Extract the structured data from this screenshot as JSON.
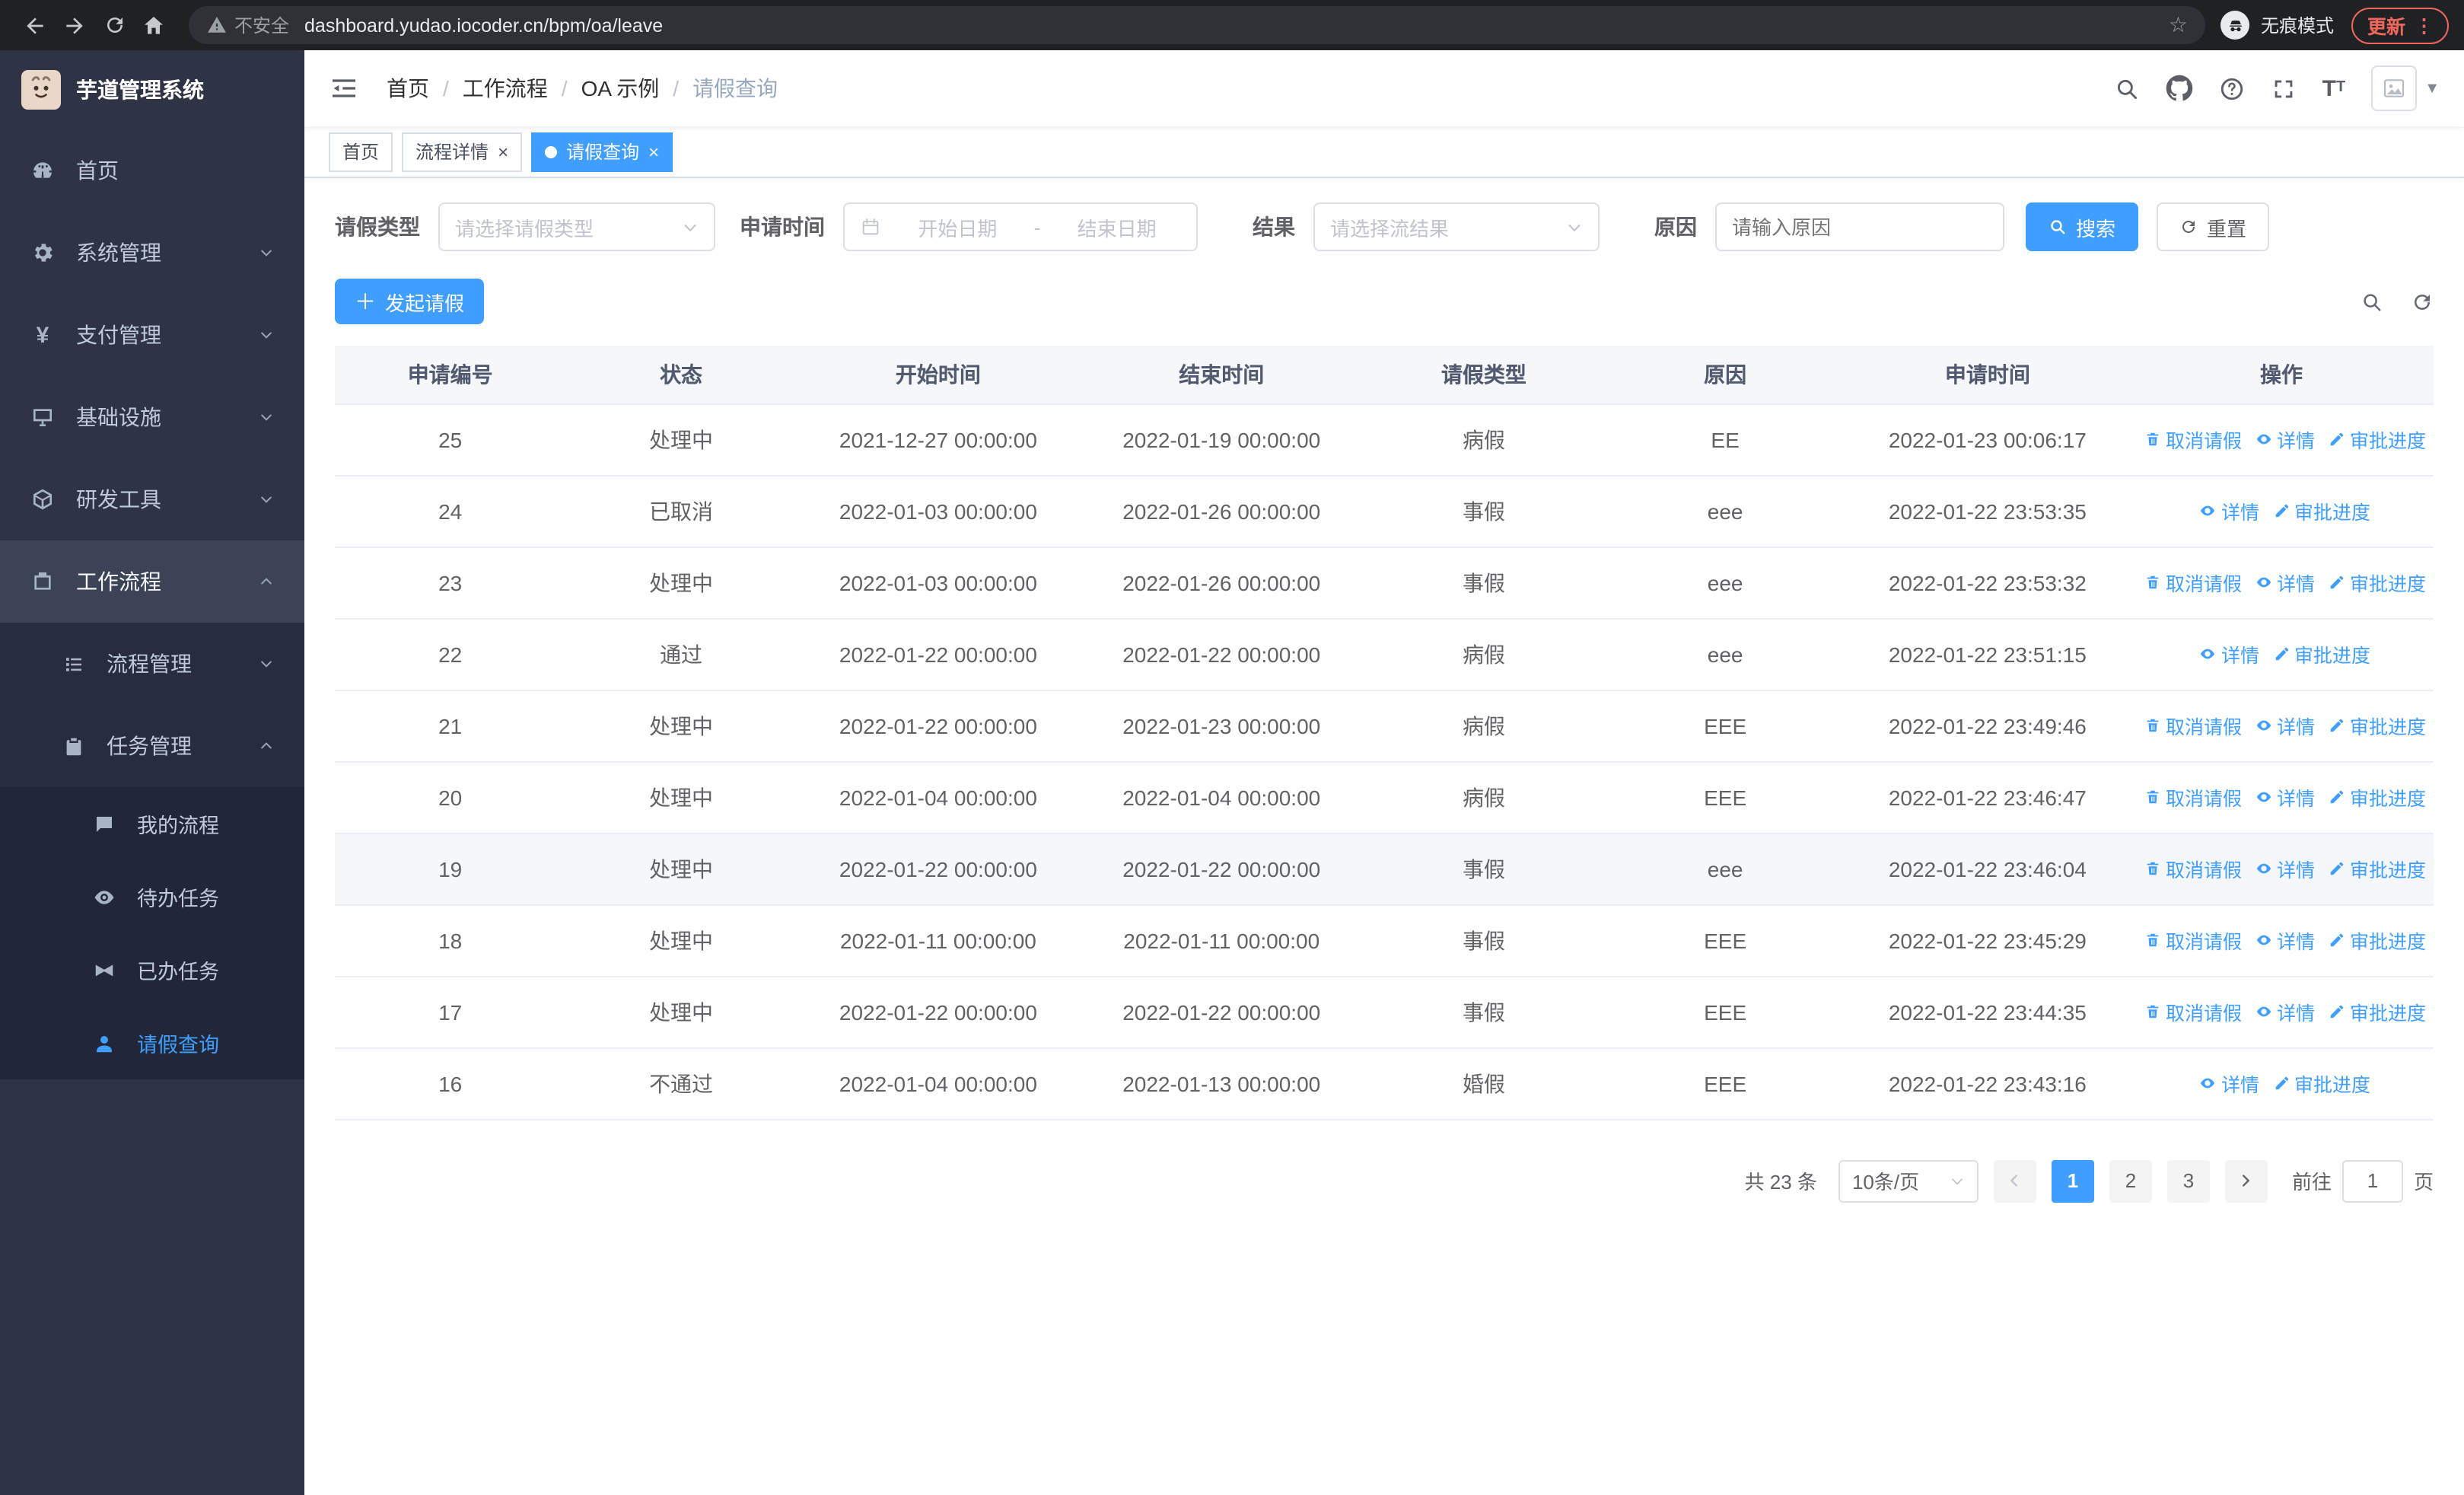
{
  "browser": {
    "warning": "不安全",
    "url": "dashboard.yudao.iocoder.cn/bpm/oa/leave",
    "incognito": "无痕模式",
    "update": "更新"
  },
  "sidebar": {
    "title": "芋道管理系统",
    "items": [
      {
        "label": "首页"
      },
      {
        "label": "系统管理"
      },
      {
        "label": "支付管理"
      },
      {
        "label": "基础设施"
      },
      {
        "label": "研发工具"
      },
      {
        "label": "工作流程"
      }
    ],
    "submenu": {
      "process_mgmt": "流程管理",
      "task_mgmt": "任务管理",
      "children": [
        {
          "label": "我的流程"
        },
        {
          "label": "待办任务"
        },
        {
          "label": "已办任务"
        },
        {
          "label": "请假查询"
        }
      ]
    }
  },
  "navbar": {
    "breadcrumb": [
      "首页",
      "工作流程",
      "OA 示例",
      "请假查询"
    ]
  },
  "tabs": [
    {
      "label": "首页"
    },
    {
      "label": "流程详情"
    },
    {
      "label": "请假查询"
    }
  ],
  "filters": {
    "leave_type_label": "请假类型",
    "leave_type_placeholder": "请选择请假类型",
    "apply_time_label": "申请时间",
    "start_date_placeholder": "开始日期",
    "range_separator": "-",
    "end_date_placeholder": "结束日期",
    "result_label": "结果",
    "result_placeholder": "请选择流结果",
    "reason_label": "原因",
    "reason_placeholder": "请输入原因",
    "search_button": "搜索",
    "reset_button": "重置"
  },
  "toolbar": {
    "create_button": "发起请假"
  },
  "table": {
    "columns": [
      "申请编号",
      "状态",
      "开始时间",
      "结束时间",
      "请假类型",
      "原因",
      "申请时间",
      "操作"
    ],
    "action_labels": {
      "cancel": "取消请假",
      "detail": "详情",
      "progress": "审批进度"
    },
    "rows": [
      {
        "id": "25",
        "status": "处理中",
        "start": "2021-12-27 00:00:00",
        "end": "2022-01-19 00:00:00",
        "type": "病假",
        "reason": "EE",
        "applied": "2022-01-23 00:06:17",
        "actions": [
          "cancel",
          "detail",
          "progress"
        ]
      },
      {
        "id": "24",
        "status": "已取消",
        "start": "2022-01-03 00:00:00",
        "end": "2022-01-26 00:00:00",
        "type": "事假",
        "reason": "eee",
        "applied": "2022-01-22 23:53:35",
        "actions": [
          "detail",
          "progress"
        ]
      },
      {
        "id": "23",
        "status": "处理中",
        "start": "2022-01-03 00:00:00",
        "end": "2022-01-26 00:00:00",
        "type": "事假",
        "reason": "eee",
        "applied": "2022-01-22 23:53:32",
        "actions": [
          "cancel",
          "detail",
          "progress"
        ]
      },
      {
        "id": "22",
        "status": "通过",
        "start": "2022-01-22 00:00:00",
        "end": "2022-01-22 00:00:00",
        "type": "病假",
        "reason": "eee",
        "applied": "2022-01-22 23:51:15",
        "actions": [
          "detail",
          "progress"
        ]
      },
      {
        "id": "21",
        "status": "处理中",
        "start": "2022-01-22 00:00:00",
        "end": "2022-01-23 00:00:00",
        "type": "病假",
        "reason": "EEE",
        "applied": "2022-01-22 23:49:46",
        "actions": [
          "cancel",
          "detail",
          "progress"
        ]
      },
      {
        "id": "20",
        "status": "处理中",
        "start": "2022-01-04 00:00:00",
        "end": "2022-01-04 00:00:00",
        "type": "病假",
        "reason": "EEE",
        "applied": "2022-01-22 23:46:47",
        "actions": [
          "cancel",
          "detail",
          "progress"
        ]
      },
      {
        "id": "19",
        "status": "处理中",
        "start": "2022-01-22 00:00:00",
        "end": "2022-01-22 00:00:00",
        "type": "事假",
        "reason": "eee",
        "applied": "2022-01-22 23:46:04",
        "actions": [
          "cancel",
          "detail",
          "progress"
        ],
        "hover": true
      },
      {
        "id": "18",
        "status": "处理中",
        "start": "2022-01-11 00:00:00",
        "end": "2022-01-11 00:00:00",
        "type": "事假",
        "reason": "EEE",
        "applied": "2022-01-22 23:45:29",
        "actions": [
          "cancel",
          "detail",
          "progress"
        ]
      },
      {
        "id": "17",
        "status": "处理中",
        "start": "2022-01-22 00:00:00",
        "end": "2022-01-22 00:00:00",
        "type": "事假",
        "reason": "EEE",
        "applied": "2022-01-22 23:44:35",
        "actions": [
          "cancel",
          "detail",
          "progress"
        ]
      },
      {
        "id": "16",
        "status": "不通过",
        "start": "2022-01-04 00:00:00",
        "end": "2022-01-13 00:00:00",
        "type": "婚假",
        "reason": "EEE",
        "applied": "2022-01-22 23:43:16",
        "actions": [
          "detail",
          "progress"
        ]
      }
    ]
  },
  "pagination": {
    "total": "共 23 条",
    "page_size": "10条/页",
    "pages": [
      "1",
      "2",
      "3"
    ],
    "active_page": "1",
    "goto_label": "前往",
    "goto_value": "1",
    "page_label": "页"
  },
  "colors": {
    "primary": "#409eff",
    "sidebar_bg": "#2e3444",
    "chrome_bg": "#202124",
    "update_accent": "#ee675c"
  }
}
